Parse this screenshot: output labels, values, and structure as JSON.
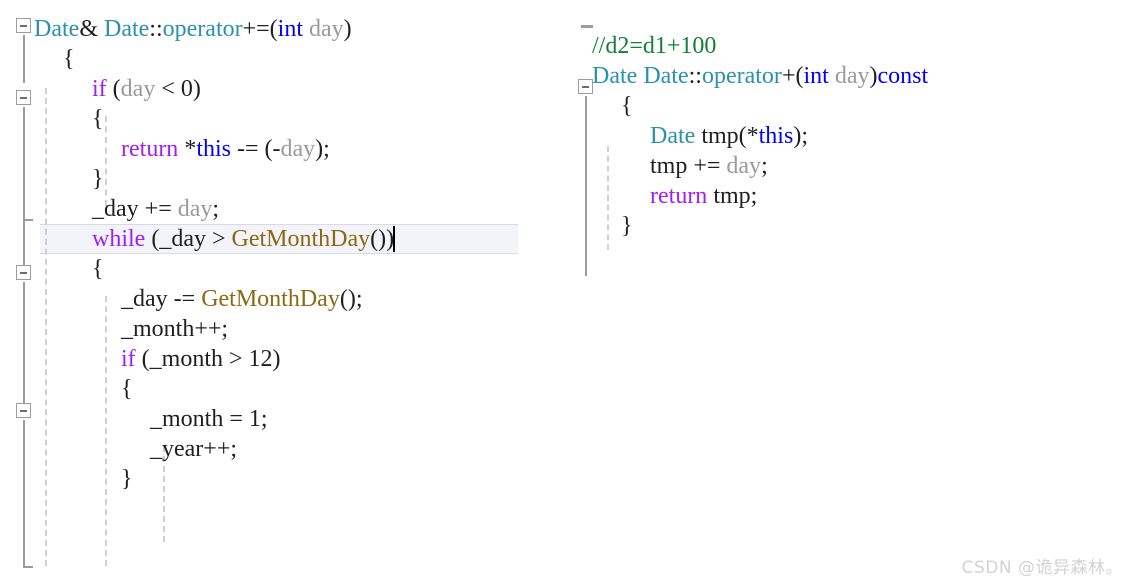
{
  "editor": {
    "app": "visual-studio-code-editor",
    "language": "C++",
    "background_color": "#ffffff",
    "current_line_highlight_color": "#f3f3fa",
    "current_line_border_color": "#dadae6",
    "colors": {
      "type": "#2b91af",
      "keyword": "#0000ff",
      "control_keyword": "#a020f0",
      "function": "#8b6914",
      "parameter": "#9a9a9a",
      "plain": "#1f1f1f",
      "comment": "#138035",
      "gutter": "#9c9c9c",
      "indent_guide": "#cfcfcf"
    }
  },
  "left_pane": {
    "name": "operator-plus-equals-definition",
    "lines": [
      {
        "indent": 0,
        "current": false,
        "tokens": [
          {
            "text": "Date",
            "cls": "t-type"
          },
          {
            "text": "& ",
            "cls": "t-plain"
          },
          {
            "text": "Date",
            "cls": "t-type"
          },
          {
            "text": "::",
            "cls": "t-plain"
          },
          {
            "text": "operator",
            "cls": "t-type"
          },
          {
            "text": "+=(",
            "cls": "t-plain"
          },
          {
            "text": "int",
            "cls": "t-keyword"
          },
          {
            "text": " ",
            "cls": "t-plain"
          },
          {
            "text": "day",
            "cls": "t-param"
          },
          {
            "text": ")",
            "cls": "t-plain"
          }
        ]
      },
      {
        "indent": 1,
        "current": false,
        "tokens": [
          {
            "text": "{",
            "cls": "t-brace"
          }
        ]
      },
      {
        "indent": 2,
        "current": false,
        "tokens": [
          {
            "text": "if",
            "cls": "t-ctrl"
          },
          {
            "text": " (",
            "cls": "t-plain"
          },
          {
            "text": "day",
            "cls": "t-param"
          },
          {
            "text": " < 0)",
            "cls": "t-plain"
          }
        ]
      },
      {
        "indent": 2,
        "current": false,
        "tokens": [
          {
            "text": "{",
            "cls": "t-brace"
          }
        ]
      },
      {
        "indent": 3,
        "current": false,
        "tokens": [
          {
            "text": "return",
            "cls": "t-ctrl"
          },
          {
            "text": " *",
            "cls": "t-plain"
          },
          {
            "text": "this",
            "cls": "t-keyword"
          },
          {
            "text": " -= (-",
            "cls": "t-plain"
          },
          {
            "text": "day",
            "cls": "t-param"
          },
          {
            "text": ");",
            "cls": "t-plain"
          }
        ]
      },
      {
        "indent": 2,
        "current": false,
        "tokens": [
          {
            "text": "}",
            "cls": "t-brace"
          }
        ]
      },
      {
        "indent": 2,
        "current": false,
        "tokens": [
          {
            "text": "_day += ",
            "cls": "t-plain"
          },
          {
            "text": "day",
            "cls": "t-param"
          },
          {
            "text": ";",
            "cls": "t-plain"
          }
        ]
      },
      {
        "indent": 2,
        "current": true,
        "caret": true,
        "tokens": [
          {
            "text": "while",
            "cls": "t-ctrl"
          },
          {
            "text": " (_day > ",
            "cls": "t-plain"
          },
          {
            "text": "GetMonthDay",
            "cls": "t-func"
          },
          {
            "text": "())",
            "cls": "t-plain"
          }
        ]
      },
      {
        "indent": 2,
        "current": false,
        "tokens": [
          {
            "text": "{",
            "cls": "t-brace"
          }
        ]
      },
      {
        "indent": 3,
        "current": false,
        "tokens": [
          {
            "text": "_day -= ",
            "cls": "t-plain"
          },
          {
            "text": "GetMonthDay",
            "cls": "t-func"
          },
          {
            "text": "();",
            "cls": "t-plain"
          }
        ]
      },
      {
        "indent": 3,
        "current": false,
        "tokens": [
          {
            "text": "_month++;",
            "cls": "t-plain"
          }
        ]
      },
      {
        "indent": 3,
        "current": false,
        "tokens": [
          {
            "text": "if",
            "cls": "t-ctrl"
          },
          {
            "text": " (_month > 12)",
            "cls": "t-plain"
          }
        ]
      },
      {
        "indent": 3,
        "current": false,
        "tokens": [
          {
            "text": "{",
            "cls": "t-brace"
          }
        ]
      },
      {
        "indent": 4,
        "current": false,
        "tokens": [
          {
            "text": "_month = 1;",
            "cls": "t-plain"
          }
        ]
      },
      {
        "indent": 4,
        "current": false,
        "tokens": [
          {
            "text": "_year++;",
            "cls": "t-plain"
          }
        ]
      },
      {
        "indent": 3,
        "current": false,
        "tokens": [
          {
            "text": "}",
            "cls": "t-brace"
          }
        ]
      }
    ]
  },
  "right_pane": {
    "name": "operator-plus-definition",
    "lines": [
      {
        "indent": 0,
        "current": false,
        "tokens": [
          {
            "text": "//d2=d1+100",
            "cls": "t-comment"
          }
        ]
      },
      {
        "indent": 0,
        "current": false,
        "tokens": [
          {
            "text": "Date",
            "cls": "t-type"
          },
          {
            "text": " ",
            "cls": "t-plain"
          },
          {
            "text": "Date",
            "cls": "t-type"
          },
          {
            "text": "::",
            "cls": "t-plain"
          },
          {
            "text": "operator",
            "cls": "t-type"
          },
          {
            "text": "+(",
            "cls": "t-plain"
          },
          {
            "text": "int",
            "cls": "t-keyword"
          },
          {
            "text": " ",
            "cls": "t-plain"
          },
          {
            "text": "day",
            "cls": "t-param"
          },
          {
            "text": ")",
            "cls": "t-plain"
          },
          {
            "text": "const",
            "cls": "t-keyword"
          }
        ]
      },
      {
        "indent": 1,
        "current": false,
        "tokens": [
          {
            "text": "{",
            "cls": "t-brace"
          }
        ]
      },
      {
        "indent": 2,
        "current": false,
        "tokens": [
          {
            "text": "Date",
            "cls": "t-type"
          },
          {
            "text": " tmp(*",
            "cls": "t-plain"
          },
          {
            "text": "this",
            "cls": "t-keyword"
          },
          {
            "text": ");",
            "cls": "t-plain"
          }
        ]
      },
      {
        "indent": 2,
        "current": false,
        "tokens": [
          {
            "text": "tmp += ",
            "cls": "t-plain"
          },
          {
            "text": "day",
            "cls": "t-param"
          },
          {
            "text": ";",
            "cls": "t-plain"
          }
        ]
      },
      {
        "indent": 2,
        "current": false,
        "tokens": [
          {
            "text": "return",
            "cls": "t-ctrl"
          },
          {
            "text": " tmp;",
            "cls": "t-plain"
          }
        ]
      },
      {
        "indent": 1,
        "current": false,
        "tokens": [
          {
            "text": "}",
            "cls": "t-brace"
          }
        ]
      }
    ]
  },
  "watermark": {
    "text": "CSDN @诡异森林。"
  }
}
